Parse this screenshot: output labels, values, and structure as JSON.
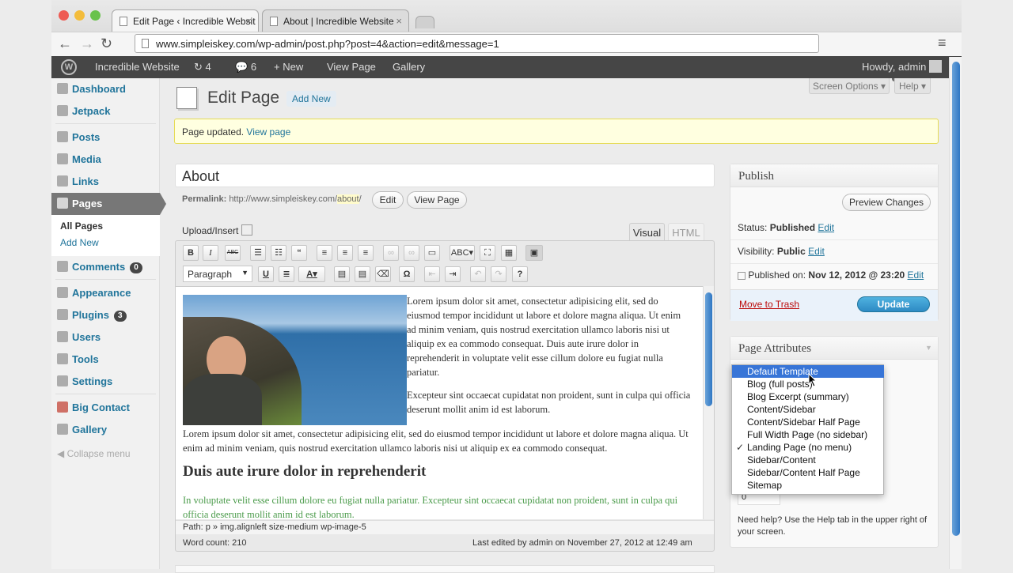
{
  "browser": {
    "tabs": [
      {
        "label": "Edit Page ‹ Incredible Websit",
        "close": "×"
      },
      {
        "label": "About | Incredible Website",
        "close": "×"
      }
    ],
    "url": "www.simpleiskey.com/wp-admin/post.php?post=4&action=edit&message=1",
    "nav": {
      "back": "←",
      "forward": "→",
      "reload": "↻"
    },
    "star": "☆",
    "menu": "≡"
  },
  "adminbar": {
    "wp_logo": "W",
    "site_name": "Incredible Website",
    "updates_count": "4",
    "comments_count": "6",
    "new_label": "+ New",
    "view_page": "View Page",
    "gallery": "Gallery",
    "howdy": "Howdy, admin"
  },
  "sidebar": {
    "items": [
      {
        "label": "Dashboard",
        "icon": "dashboard-icon"
      },
      {
        "label": "Jetpack",
        "icon": "jetpack-icon"
      },
      {
        "label": "Posts",
        "icon": "pin-icon"
      },
      {
        "label": "Media",
        "icon": "media-icon"
      },
      {
        "label": "Links",
        "icon": "link-icon"
      },
      {
        "label": "Pages",
        "icon": "pages-icon"
      },
      {
        "label": "Comments",
        "icon": "comments-icon",
        "badge": "0"
      },
      {
        "label": "Appearance",
        "icon": "appearance-icon"
      },
      {
        "label": "Plugins",
        "icon": "plugins-icon",
        "badge": "3"
      },
      {
        "label": "Users",
        "icon": "users-icon"
      },
      {
        "label": "Tools",
        "icon": "tools-icon"
      },
      {
        "label": "Settings",
        "icon": "settings-icon"
      },
      {
        "label": "Big Contact",
        "icon": "contact-icon"
      },
      {
        "label": "Gallery",
        "icon": "gallery-icon"
      }
    ],
    "submenu": [
      "All Pages",
      "Add New"
    ],
    "collapse": "Collapse menu"
  },
  "header": {
    "title": "Edit Page",
    "add_new": "Add New",
    "screen_options": "Screen Options",
    "help": "Help"
  },
  "notice": {
    "text": "Page updated.",
    "link": "View page"
  },
  "post": {
    "title": "About",
    "permalink_label": "Permalink:",
    "permalink_base": "http://www.simpleiskey.com/",
    "permalink_slug": "about",
    "permalink_end": "/",
    "edit_btn": "Edit",
    "view_btn": "View Page",
    "upload_insert": "Upload/Insert",
    "tab_visual": "Visual",
    "tab_html": "HTML",
    "format_select": "Paragraph",
    "para1": "Lorem ipsum dolor sit amet, consectetur adipisicing elit, sed do eiusmod tempor incididunt ut labore et dolore magna aliqua. Ut enim ad minim veniam, quis nostrud exercitation ullamco laboris nisi ut aliquip ex ea commodo consequat. Duis aute irure dolor in reprehenderit in voluptate velit esse cillum dolore eu fugiat nulla pariatur.",
    "para2": "Excepteur sint occaecat cupidatat non proident, sunt in culpa qui officia deserunt mollit anim id est laborum.",
    "para3": "Lorem ipsum dolor sit amet, consectetur adipisicing elit, sed do eiusmod tempor incididunt ut labore et dolore magna aliqua. Ut enim ad minim veniam, quis nostrud exercitation ullamco laboris nisi ut aliquip ex ea commodo consequat.",
    "heading": "Duis aute irure dolor in reprehenderit",
    "para4": "In voluptate velit esse cillum dolore eu fugiat nulla pariatur. Excepteur sint occaecat cupidatat non proident, sunt in culpa qui officia deserunt mollit anim id est laborum.",
    "path": "Path: p » img.alignleft size-medium wp-image-5",
    "word_count": "Word count: 210",
    "last_edited": "Last edited by admin on November 27, 2012 at 12:49 am"
  },
  "publish": {
    "title": "Publish",
    "preview": "Preview Changes",
    "status_label": "Status:",
    "status_value": "Published",
    "visibility_label": "Visibility:",
    "visibility_value": "Public",
    "published_on_label": "Published on:",
    "published_on_value": "Nov 12, 2012 @ 23:20",
    "edit": "Edit",
    "trash": "Move to Trash",
    "update": "Update"
  },
  "attributes": {
    "title": "Page Attributes",
    "order_value": "0",
    "help_text": "Need help? Use the Help tab in the upper right of your screen.",
    "template_options": [
      "Default Template",
      "Blog (full posts)",
      "Blog Excerpt (summary)",
      "Content/Sidebar",
      "Content/Sidebar Half Page",
      "Full Width Page (no sidebar)",
      "Landing Page (no menu)",
      "Sidebar/Content",
      "Sidebar/Content Half Page",
      "Sitemap"
    ],
    "checked_mark": "✓"
  },
  "colors": {
    "link": "#21759b",
    "adminbar": "#464646",
    "highlight": "#3875d7",
    "update": "#2e9fd2"
  }
}
